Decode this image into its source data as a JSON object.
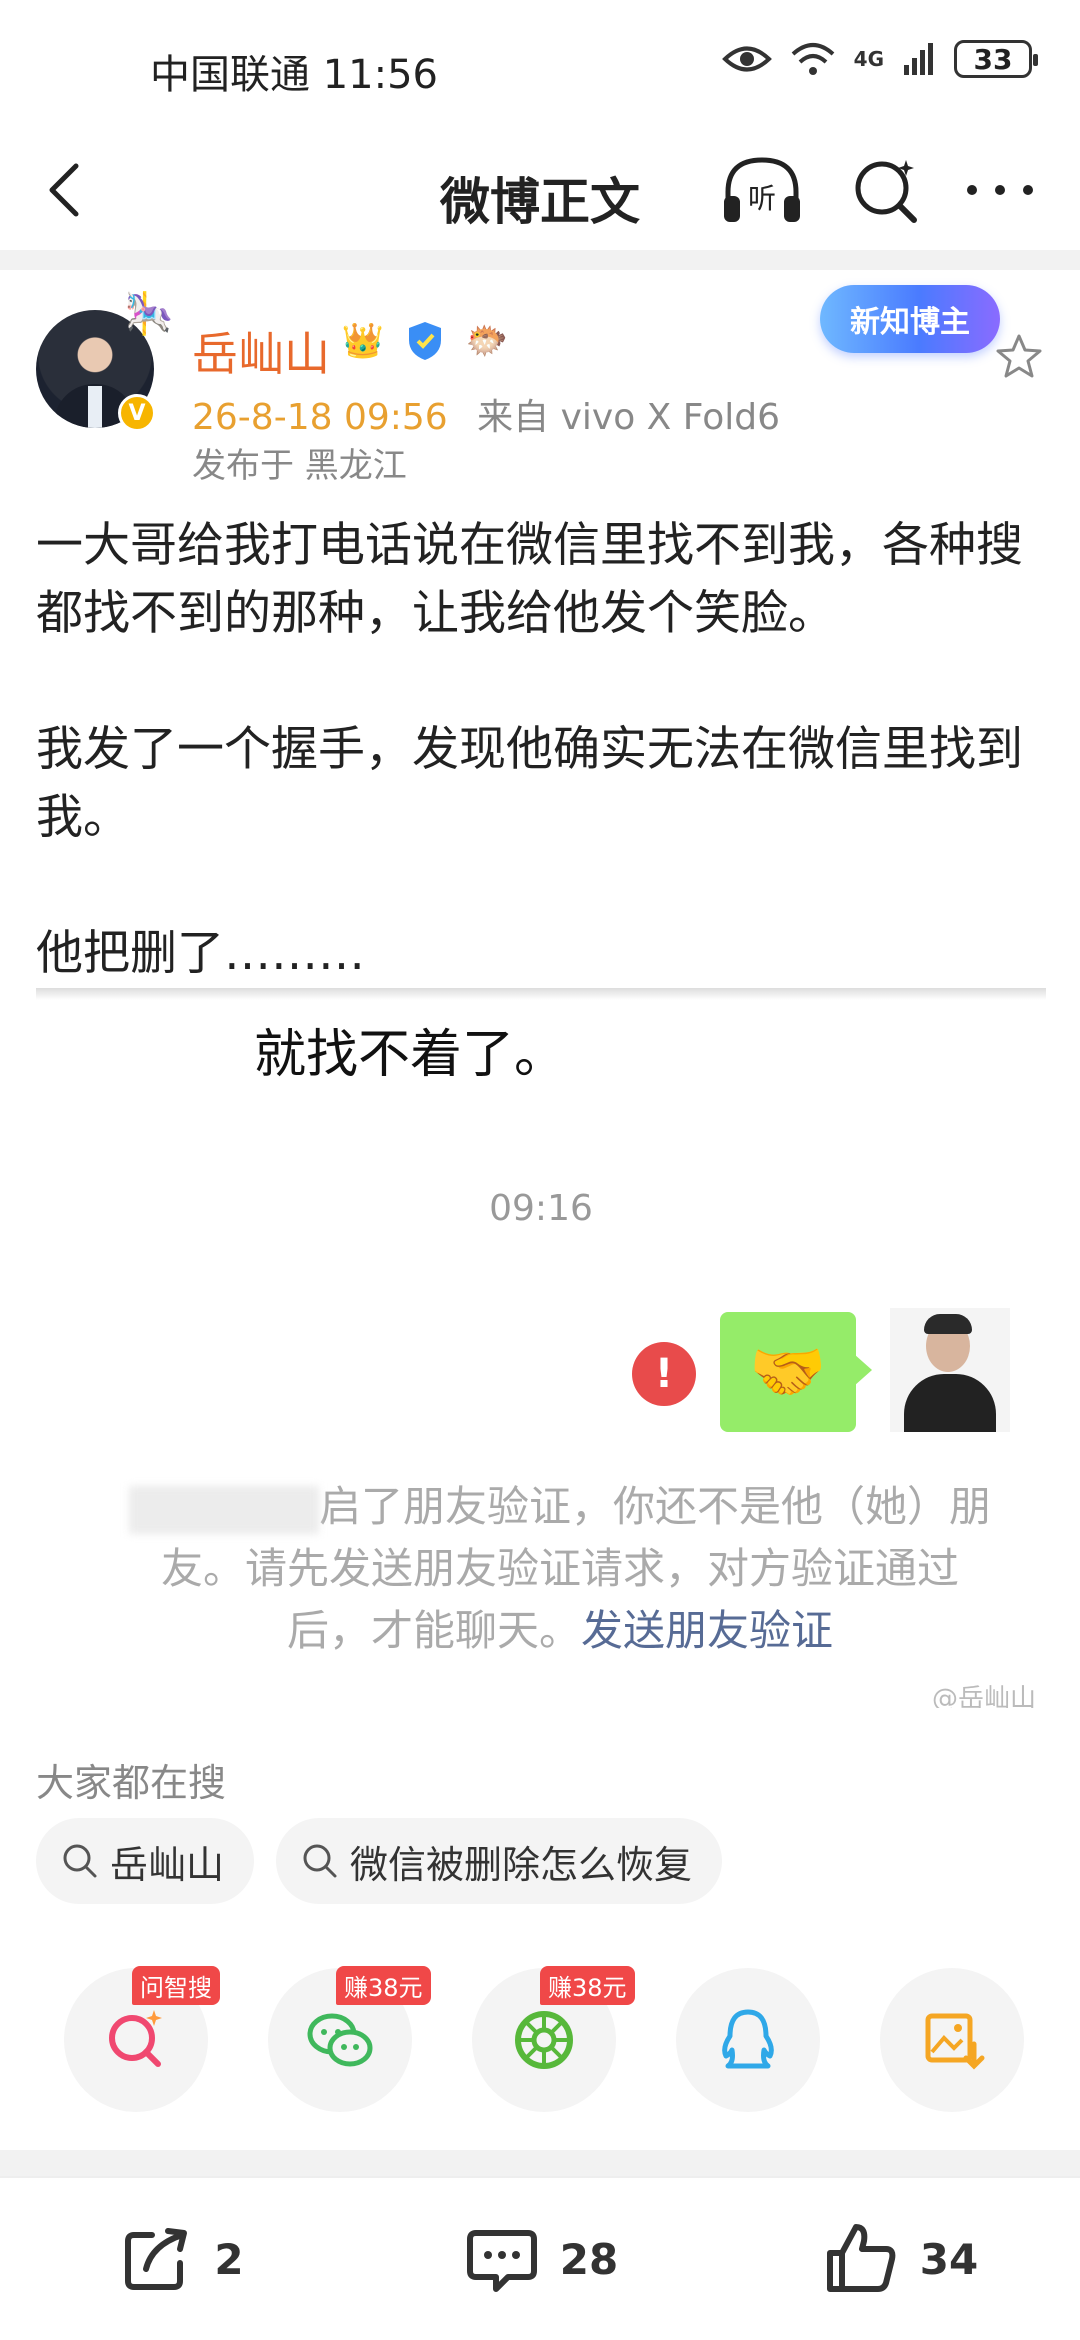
{
  "status_bar": {
    "carrier_time": "中国联通 11:56",
    "battery": "33",
    "network": "4G"
  },
  "nav": {
    "title": "微博正文",
    "listen_label": "听"
  },
  "post": {
    "username": "岳屾山",
    "time": "26-8-18 09:56",
    "source": "来自 vivo X Fold6",
    "location": "发布于 黑龙江",
    "verified_mark": "V",
    "newbie_badge": "新知博主",
    "paragraphs": [
      "一大哥给我打电话说在微信里找不到我，各种搜都找不到的那种，让我给他发个笑脸。",
      "我发了一个握手，发现他确实无法在微信里找到我。",
      "他把删了………"
    ]
  },
  "embed": {
    "cut_text": "就找不着了。",
    "time": "09:16",
    "bubble_emoji": "🤝",
    "warning": "!",
    "system_note_part": "启了朋友验证，你还不是他（她）朋友。请先发送朋友验证请求，对方验证通过后，才能聊天。",
    "system_note_link": "发送朋友验证",
    "watermark": "@岳屾山"
  },
  "trending": {
    "title": "大家都在搜",
    "chips": [
      "岳屾山",
      "微信被删除怎么恢复"
    ]
  },
  "share_row": {
    "items": [
      {
        "icon": "zhisou-icon",
        "tag": "问智搜"
      },
      {
        "icon": "wechat-icon",
        "tag": "赚38元"
      },
      {
        "icon": "moments-icon",
        "tag": "赚38元"
      },
      {
        "icon": "qq-icon",
        "tag": ""
      },
      {
        "icon": "save-image-icon",
        "tag": ""
      }
    ]
  },
  "actions": {
    "reposts": "2",
    "comments": "28",
    "likes": "34"
  },
  "colors": {
    "username": "#e8692c",
    "time": "#e8a030",
    "wechat_green": "#95ec69",
    "link": "#576b95"
  }
}
